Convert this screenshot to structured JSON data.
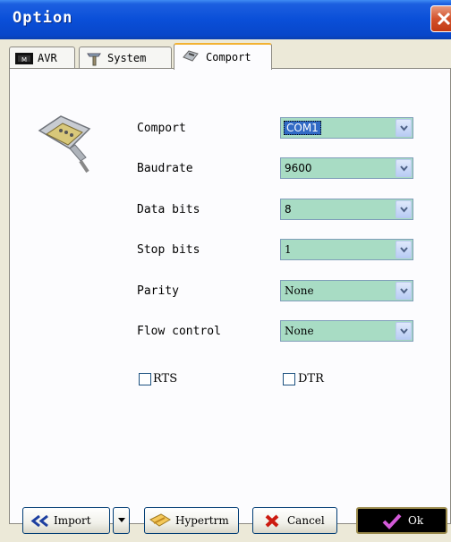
{
  "window": {
    "title": "Option"
  },
  "tabs": [
    {
      "label": "AVR",
      "icon": "chip-icon"
    },
    {
      "label": "System",
      "icon": "tools-icon"
    },
    {
      "label": "Comport",
      "icon": "serial-plug-icon",
      "active": true
    }
  ],
  "fields": [
    {
      "label": "Comport",
      "value": "COM1"
    },
    {
      "label": "Baudrate",
      "value": "9600"
    },
    {
      "label": "Data bits",
      "value": "8"
    },
    {
      "label": "Stop bits",
      "value": "1"
    },
    {
      "label": "Parity",
      "value": "None"
    },
    {
      "label": "Flow control",
      "value": "None"
    }
  ],
  "checkboxes": [
    {
      "label": "RTS",
      "checked": false
    },
    {
      "label": "DTR",
      "checked": false
    }
  ],
  "buttons": {
    "import": "Import",
    "hypertrm": "Hypertrm",
    "cancel": "Cancel",
    "ok": "Ok"
  },
  "colors": {
    "combo_bg": "#a8dcc4",
    "titlebar": "#0a4fd8",
    "selection": "#316ac5"
  }
}
